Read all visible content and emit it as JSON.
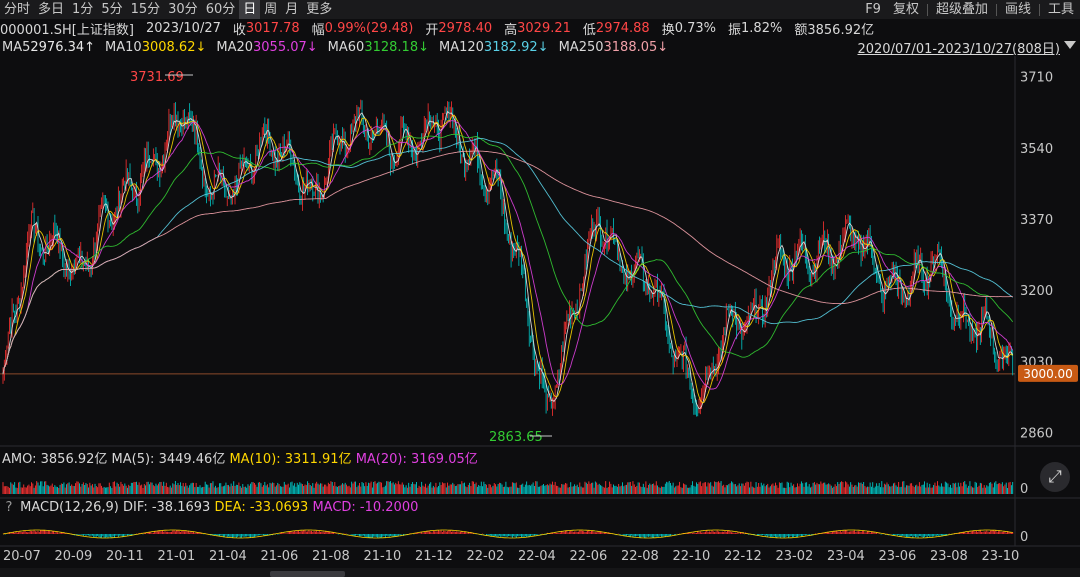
{
  "toolbar": {
    "tabs": [
      "分时",
      "多日",
      "1分",
      "5分",
      "15分",
      "30分",
      "60分",
      "日",
      "周",
      "月",
      "更多"
    ],
    "active_tab": "日",
    "right": [
      "F9",
      "复权",
      "超级叠加",
      "画线",
      "工具"
    ]
  },
  "quote": {
    "code": "000001.SH[上证指数]",
    "date": "2023/10/27",
    "close_label": "收",
    "close": "3017.78",
    "change_label": "幅",
    "change": "0.99%(29.48)",
    "open_label": "开",
    "open": "2978.40",
    "high_label": "高",
    "high": "3029.21",
    "low_label": "低",
    "low": "2974.88",
    "turnover_label": "换",
    "turnover": "0.73%",
    "amplitude_label": "振",
    "amplitude": "1.82%",
    "amount_label": "额",
    "amount": "3856.92亿"
  },
  "ma": [
    {
      "label": "MA5",
      "value": "2976.34↑",
      "color": "#e8e8e8"
    },
    {
      "label": "MA10",
      "value": "3008.62↓",
      "color": "#ffd700"
    },
    {
      "label": "MA20",
      "value": "3055.07↓",
      "color": "#e040e0"
    },
    {
      "label": "MA60",
      "value": "3128.18↓",
      "color": "#33cc33"
    },
    {
      "label": "MA120",
      "value": "3182.92↓",
      "color": "#5ad0e6"
    },
    {
      "label": "MA250",
      "value": "3188.05↓",
      "color": "#f0a0a8"
    }
  ],
  "range": "2020/07/01-2023/10/27(808日)",
  "chart_data": {
    "type": "candlestick",
    "y_ticks": [
      "3710",
      "3540",
      "3370",
      "3200",
      "3030",
      "2860"
    ],
    "ylim": [
      2830,
      3750
    ],
    "current_price": "3000.00",
    "annotations": {
      "high": "3731.69",
      "low": "2863.65"
    },
    "x_ticks": [
      "20-07",
      "20-09",
      "20-11",
      "21-01",
      "21-04",
      "21-06",
      "21-08",
      "21-10",
      "21-12",
      "22-02",
      "22-04",
      "22-06",
      "22-08",
      "22-10",
      "22-12",
      "23-02",
      "23-04",
      "23-06",
      "23-08",
      "23-10"
    ],
    "close_series": [
      {
        "x": "20-07",
        "y": 3000
      },
      {
        "x": "20-08",
        "y": 3330
      },
      {
        "x": "20-09",
        "y": 3310
      },
      {
        "x": "20-10",
        "y": 3240
      },
      {
        "x": "20-11",
        "y": 3380
      },
      {
        "x": "20-12",
        "y": 3450
      },
      {
        "x": "21-01",
        "y": 3520
      },
      {
        "x": "21-02",
        "y": 3640
      },
      {
        "x": "21-03",
        "y": 3440
      },
      {
        "x": "21-04",
        "y": 3440
      },
      {
        "x": "21-05",
        "y": 3560
      },
      {
        "x": "21-06",
        "y": 3520
      },
      {
        "x": "21-07",
        "y": 3420
      },
      {
        "x": "21-08",
        "y": 3560
      },
      {
        "x": "21-09",
        "y": 3600
      },
      {
        "x": "21-10",
        "y": 3540
      },
      {
        "x": "21-11",
        "y": 3560
      },
      {
        "x": "21-12",
        "y": 3620
      },
      {
        "x": "22-01",
        "y": 3520
      },
      {
        "x": "22-02",
        "y": 3460
      },
      {
        "x": "22-03",
        "y": 3250
      },
      {
        "x": "22-04",
        "y": 2900
      },
      {
        "x": "22-05",
        "y": 3150
      },
      {
        "x": "22-06",
        "y": 3380
      },
      {
        "x": "22-07",
        "y": 3250
      },
      {
        "x": "22-08",
        "y": 3230
      },
      {
        "x": "22-09",
        "y": 3040
      },
      {
        "x": "22-10",
        "y": 2940
      },
      {
        "x": "22-11",
        "y": 3130
      },
      {
        "x": "22-12",
        "y": 3120
      },
      {
        "x": "23-01",
        "y": 3280
      },
      {
        "x": "23-02",
        "y": 3280
      },
      {
        "x": "23-03",
        "y": 3290
      },
      {
        "x": "23-04",
        "y": 3340
      },
      {
        "x": "23-05",
        "y": 3210
      },
      {
        "x": "23-06",
        "y": 3210
      },
      {
        "x": "23-07",
        "y": 3280
      },
      {
        "x": "23-08",
        "y": 3120
      },
      {
        "x": "23-09",
        "y": 3110
      },
      {
        "x": "23-10",
        "y": 3010
      }
    ]
  },
  "amo": {
    "label": "AMO: 3856.92亿",
    "ma5": "MA(5): 3449.46亿",
    "ma10": "MA(10): 3311.91亿",
    "ma20": "MA(20): 3169.05亿",
    "zero": "0"
  },
  "macd": {
    "q": "?",
    "label": "MACD(12,26,9)",
    "dif": "DIF: -38.1693",
    "dea": "DEA: -33.0693",
    "macd": "MACD: -10.2000",
    "zero": "0"
  },
  "colors": {
    "up": "#ff3232",
    "down": "#00c8c8",
    "bg": "#0d0d0f",
    "grid": "#2a2a30"
  }
}
